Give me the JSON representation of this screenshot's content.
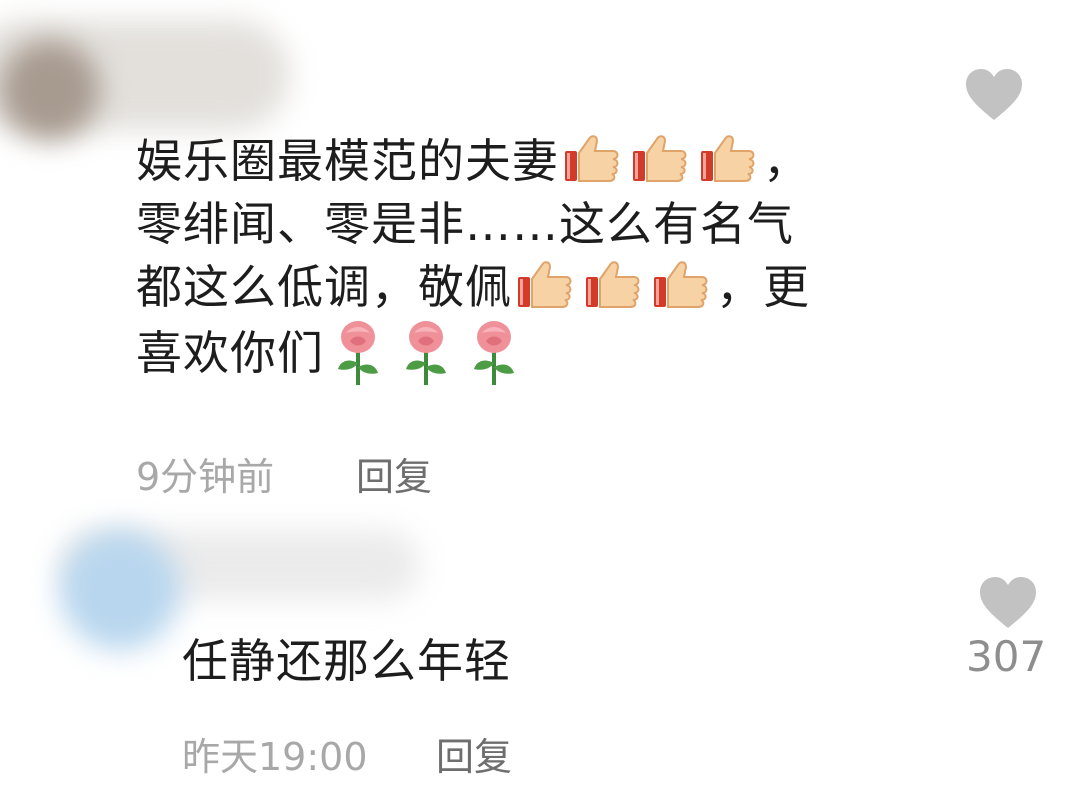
{
  "comments": [
    {
      "text_part1": "娱乐圈最模范的夫妻",
      "text_part2": "，\n零绯闻、零是非……这么有名气\n都这么低调，敬佩",
      "text_part3": "，更\n喜欢你们",
      "time": "9分钟前",
      "reply_label": "回复",
      "like_count": ""
    },
    {
      "text": "任静还那么年轻",
      "time": "昨天19:00",
      "reply_label": "回复",
      "like_count": "307"
    }
  ],
  "icons": {
    "like": "heart-icon",
    "thumbs": "thumbs-up-emoji",
    "rose": "rose-emoji"
  },
  "colors": {
    "heart": "#c2c2c2",
    "text": "#1d1d1d",
    "meta": "#a8a8a8",
    "reply": "#6e6e6e"
  }
}
